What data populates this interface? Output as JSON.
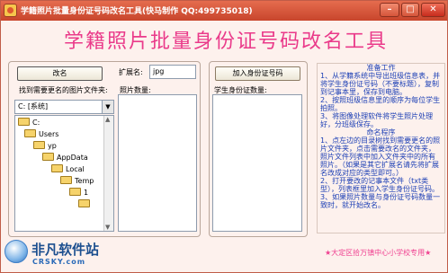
{
  "window": {
    "title": "学籍照片批量身份证号码改名工具(快马制作  QQ:499735018)",
    "controls": {
      "minimize": "–",
      "maximize": "□",
      "close": "✕"
    }
  },
  "headline": "学籍照片批量身份证号码改名工具",
  "left_panel": {
    "rename_button": "改名",
    "folder_label": "找到需要更名的图片文件夹:",
    "drive_value": "C: [系统]",
    "tree": [
      "C:",
      "Users",
      "yp",
      "AppData",
      "Local",
      "Temp",
      "1",
      ""
    ]
  },
  "ext": {
    "label": "扩展名:",
    "value": "jpg"
  },
  "photo_count_label": "照片数量:",
  "id_panel": {
    "add_button": "加入身份证号码",
    "count_label": "学生身份证数量:"
  },
  "info": {
    "work_title": "准备工作",
    "work_1": "1、从学籍系统中导出班级信息表，并将学生身份证号码（不要标题），复制到记事本里，保存到电脑。",
    "work_2": "2、按照班级信息里的顺序为每位学生拍照。",
    "work_3": "3、将图像处理软件将学生照片处理好，分班级保存。",
    "steps_title": "命名程序",
    "step_1": "1、点左边的目录树找到需要更名的照片文件夹，点击需要改名的文件夹，照片文件列表中加入文件夹中的所有照片。（如果是其它扩展名请先将扩展名改成对应的类型即可。）",
    "step_2": "2、打开要改的记事本文件（txt类型），列表框里加入学生身份证号码。",
    "step_3": "3、如果照片数量与身份证号码数量一致时，就开始改名。"
  },
  "footer_note": "★大定区拾万镇中心小学校专用★",
  "watermark": {
    "cn": "非凡软件站",
    "en": "CRSKY.com"
  },
  "colors": {
    "titlebar": "#d5553a",
    "headline": "#ea3a8a",
    "info_text": "#1c3fb5",
    "footer": "#f04090",
    "background": "#fdf1ed"
  }
}
